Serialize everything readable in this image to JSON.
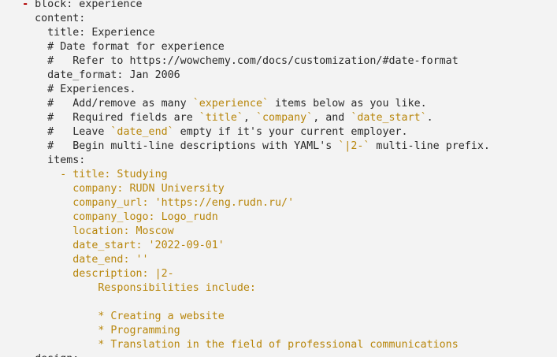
{
  "colors": {
    "background": "#f3f3f3",
    "text": "#2a2a2a",
    "inline_code": "#b8860b",
    "list_dash_accent": "#b00000"
  },
  "lines": [
    {
      "indent": "  ",
      "segments": [
        {
          "t": "- ",
          "c": "dash"
        },
        {
          "t": "block: experience",
          "c": "key"
        }
      ]
    },
    {
      "indent": "  ",
      "segments": [
        {
          "t": "  content:",
          "c": "key"
        }
      ]
    },
    {
      "indent": "      ",
      "segments": [
        {
          "t": "title: Experience",
          "c": "key"
        }
      ]
    },
    {
      "indent": "      ",
      "segments": [
        {
          "t": "# Date format for experience",
          "c": "comment"
        }
      ]
    },
    {
      "indent": "      ",
      "segments": [
        {
          "t": "#   Refer to https://wowchemy.com/docs/customization/#date-format",
          "c": "comment"
        }
      ]
    },
    {
      "indent": "      ",
      "segments": [
        {
          "t": "date_format: Jan 2006",
          "c": "key"
        }
      ]
    },
    {
      "indent": "      ",
      "segments": [
        {
          "t": "# Experiences.",
          "c": "comment"
        }
      ]
    },
    {
      "indent": "      ",
      "segments": [
        {
          "t": "#   Add/remove as many ",
          "c": "comment"
        },
        {
          "t": "`experience`",
          "c": "code"
        },
        {
          "t": " items below as you like.",
          "c": "comment"
        }
      ]
    },
    {
      "indent": "      ",
      "segments": [
        {
          "t": "#   Required fields are ",
          "c": "comment"
        },
        {
          "t": "`title`",
          "c": "code"
        },
        {
          "t": ", ",
          "c": "comment"
        },
        {
          "t": "`company`",
          "c": "code"
        },
        {
          "t": ", and ",
          "c": "comment"
        },
        {
          "t": "`date_start`",
          "c": "code"
        },
        {
          "t": ".",
          "c": "comment"
        }
      ]
    },
    {
      "indent": "      ",
      "segments": [
        {
          "t": "#   Leave ",
          "c": "comment"
        },
        {
          "t": "`date_end`",
          "c": "code"
        },
        {
          "t": " empty if it's your current employer.",
          "c": "comment"
        }
      ]
    },
    {
      "indent": "      ",
      "segments": [
        {
          "t": "#   Begin multi-line descriptions with YAML's ",
          "c": "comment"
        },
        {
          "t": "`|2-`",
          "c": "code"
        },
        {
          "t": " multi-line prefix.",
          "c": "comment"
        }
      ]
    },
    {
      "indent": "      ",
      "segments": [
        {
          "t": "items:",
          "c": "key"
        }
      ]
    },
    {
      "indent": "        ",
      "segments": [
        {
          "t": "- ",
          "c": "code"
        },
        {
          "t": "title: Studying",
          "c": "code"
        }
      ]
    },
    {
      "indent": "          ",
      "segments": [
        {
          "t": "company: RUDN University",
          "c": "code"
        }
      ]
    },
    {
      "indent": "          ",
      "segments": [
        {
          "t": "company_url: 'https://eng.rudn.ru/'",
          "c": "code"
        }
      ]
    },
    {
      "indent": "          ",
      "segments": [
        {
          "t": "company_logo: Logo_rudn",
          "c": "code"
        }
      ]
    },
    {
      "indent": "          ",
      "segments": [
        {
          "t": "location: Moscow",
          "c": "code"
        }
      ]
    },
    {
      "indent": "          ",
      "segments": [
        {
          "t": "date_start: '2022-09-01'",
          "c": "code"
        }
      ]
    },
    {
      "indent": "          ",
      "segments": [
        {
          "t": "date_end: ''",
          "c": "code"
        }
      ]
    },
    {
      "indent": "          ",
      "segments": [
        {
          "t": "description: |2-",
          "c": "code"
        }
      ]
    },
    {
      "indent": "              ",
      "segments": [
        {
          "t": "Responsibilities include:",
          "c": "code"
        }
      ]
    },
    {
      "indent": "",
      "segments": []
    },
    {
      "indent": "              ",
      "segments": [
        {
          "t": "* Creating a website",
          "c": "code"
        }
      ]
    },
    {
      "indent": "              ",
      "segments": [
        {
          "t": "* Programming",
          "c": "code"
        }
      ]
    },
    {
      "indent": "              ",
      "segments": [
        {
          "t": "* Translation in the field of professional communications",
          "c": "code"
        }
      ]
    },
    {
      "indent": "    ",
      "segments": [
        {
          "t": "design:",
          "c": "key"
        }
      ]
    }
  ]
}
